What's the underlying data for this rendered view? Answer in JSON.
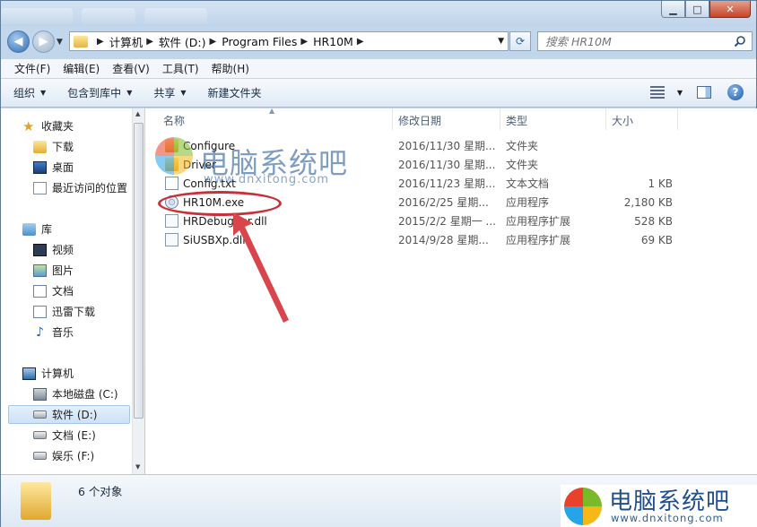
{
  "window": {
    "controls": {
      "minimize": "▁",
      "maximize": "□",
      "close": "✕"
    }
  },
  "address": {
    "crumbs": [
      "计算机",
      "软件 (D:)",
      "Program Files",
      "HR10M"
    ],
    "search_placeholder": "搜索 HR10M"
  },
  "menu": [
    "文件(F)",
    "编辑(E)",
    "查看(V)",
    "工具(T)",
    "帮助(H)"
  ],
  "toolbar": {
    "organize": "组织",
    "include": "包含到库中",
    "share": "共享",
    "new_folder": "新建文件夹"
  },
  "nav": {
    "favorites": {
      "label": "收藏夹",
      "items": [
        "下载",
        "桌面",
        "最近访问的位置"
      ]
    },
    "libraries": {
      "label": "库",
      "items": [
        "视频",
        "图片",
        "文档",
        "迅雷下载",
        "音乐"
      ]
    },
    "computer": {
      "label": "计算机",
      "items": [
        "本地磁盘 (C:)",
        "软件 (D:)",
        "文档 (E:)",
        "娱乐 (F:)"
      ]
    }
  },
  "columns": {
    "name": "名称",
    "date": "修改日期",
    "type": "类型",
    "size": "大小"
  },
  "files": [
    {
      "name": "Configure",
      "date": "2016/11/30 星期...",
      "type": "文件夹",
      "size": "",
      "icon": "folder-icon"
    },
    {
      "name": "Driver",
      "date": "2016/11/30 星期...",
      "type": "文件夹",
      "size": "",
      "icon": "folder-icon"
    },
    {
      "name": "Config.txt",
      "date": "2016/11/23 星期...",
      "type": "文本文档",
      "size": "1 KB",
      "icon": "text-file-icon"
    },
    {
      "name": "HR10M.exe",
      "date": "2016/2/25 星期...",
      "type": "应用程序",
      "size": "2,180 KB",
      "icon": "exe-icon"
    },
    {
      "name": "HRDebugger.dll",
      "date": "2015/2/2 星期一 ...",
      "type": "应用程序扩展",
      "size": "528 KB",
      "icon": "dll-icon"
    },
    {
      "name": "SiUSBXp.dll",
      "date": "2014/9/28 星期...",
      "type": "应用程序扩展",
      "size": "69 KB",
      "icon": "dll-icon"
    }
  ],
  "details": {
    "count": "6 个对象"
  },
  "watermark": {
    "title": "电脑系统吧",
    "url": "www.dnxitong.com",
    "colors": [
      "#e8412c",
      "#7ab929",
      "#25a4e8",
      "#f6b817"
    ]
  }
}
